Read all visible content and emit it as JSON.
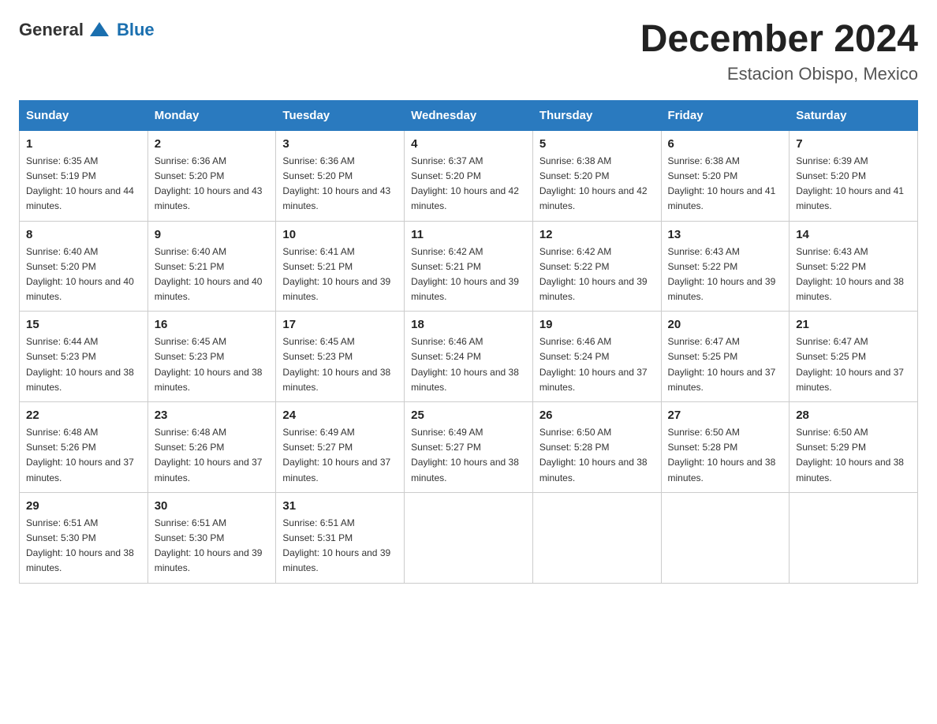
{
  "header": {
    "logo_general": "General",
    "logo_blue": "Blue",
    "month_year": "December 2024",
    "location": "Estacion Obispo, Mexico"
  },
  "weekdays": [
    "Sunday",
    "Monday",
    "Tuesday",
    "Wednesday",
    "Thursday",
    "Friday",
    "Saturday"
  ],
  "weeks": [
    [
      {
        "day": "1",
        "sunrise": "6:35 AM",
        "sunset": "5:19 PM",
        "daylight": "10 hours and 44 minutes."
      },
      {
        "day": "2",
        "sunrise": "6:36 AM",
        "sunset": "5:20 PM",
        "daylight": "10 hours and 43 minutes."
      },
      {
        "day": "3",
        "sunrise": "6:36 AM",
        "sunset": "5:20 PM",
        "daylight": "10 hours and 43 minutes."
      },
      {
        "day": "4",
        "sunrise": "6:37 AM",
        "sunset": "5:20 PM",
        "daylight": "10 hours and 42 minutes."
      },
      {
        "day": "5",
        "sunrise": "6:38 AM",
        "sunset": "5:20 PM",
        "daylight": "10 hours and 42 minutes."
      },
      {
        "day": "6",
        "sunrise": "6:38 AM",
        "sunset": "5:20 PM",
        "daylight": "10 hours and 41 minutes."
      },
      {
        "day": "7",
        "sunrise": "6:39 AM",
        "sunset": "5:20 PM",
        "daylight": "10 hours and 41 minutes."
      }
    ],
    [
      {
        "day": "8",
        "sunrise": "6:40 AM",
        "sunset": "5:20 PM",
        "daylight": "10 hours and 40 minutes."
      },
      {
        "day": "9",
        "sunrise": "6:40 AM",
        "sunset": "5:21 PM",
        "daylight": "10 hours and 40 minutes."
      },
      {
        "day": "10",
        "sunrise": "6:41 AM",
        "sunset": "5:21 PM",
        "daylight": "10 hours and 39 minutes."
      },
      {
        "day": "11",
        "sunrise": "6:42 AM",
        "sunset": "5:21 PM",
        "daylight": "10 hours and 39 minutes."
      },
      {
        "day": "12",
        "sunrise": "6:42 AM",
        "sunset": "5:22 PM",
        "daylight": "10 hours and 39 minutes."
      },
      {
        "day": "13",
        "sunrise": "6:43 AM",
        "sunset": "5:22 PM",
        "daylight": "10 hours and 39 minutes."
      },
      {
        "day": "14",
        "sunrise": "6:43 AM",
        "sunset": "5:22 PM",
        "daylight": "10 hours and 38 minutes."
      }
    ],
    [
      {
        "day": "15",
        "sunrise": "6:44 AM",
        "sunset": "5:23 PM",
        "daylight": "10 hours and 38 minutes."
      },
      {
        "day": "16",
        "sunrise": "6:45 AM",
        "sunset": "5:23 PM",
        "daylight": "10 hours and 38 minutes."
      },
      {
        "day": "17",
        "sunrise": "6:45 AM",
        "sunset": "5:23 PM",
        "daylight": "10 hours and 38 minutes."
      },
      {
        "day": "18",
        "sunrise": "6:46 AM",
        "sunset": "5:24 PM",
        "daylight": "10 hours and 38 minutes."
      },
      {
        "day": "19",
        "sunrise": "6:46 AM",
        "sunset": "5:24 PM",
        "daylight": "10 hours and 37 minutes."
      },
      {
        "day": "20",
        "sunrise": "6:47 AM",
        "sunset": "5:25 PM",
        "daylight": "10 hours and 37 minutes."
      },
      {
        "day": "21",
        "sunrise": "6:47 AM",
        "sunset": "5:25 PM",
        "daylight": "10 hours and 37 minutes."
      }
    ],
    [
      {
        "day": "22",
        "sunrise": "6:48 AM",
        "sunset": "5:26 PM",
        "daylight": "10 hours and 37 minutes."
      },
      {
        "day": "23",
        "sunrise": "6:48 AM",
        "sunset": "5:26 PM",
        "daylight": "10 hours and 37 minutes."
      },
      {
        "day": "24",
        "sunrise": "6:49 AM",
        "sunset": "5:27 PM",
        "daylight": "10 hours and 37 minutes."
      },
      {
        "day": "25",
        "sunrise": "6:49 AM",
        "sunset": "5:27 PM",
        "daylight": "10 hours and 38 minutes."
      },
      {
        "day": "26",
        "sunrise": "6:50 AM",
        "sunset": "5:28 PM",
        "daylight": "10 hours and 38 minutes."
      },
      {
        "day": "27",
        "sunrise": "6:50 AM",
        "sunset": "5:28 PM",
        "daylight": "10 hours and 38 minutes."
      },
      {
        "day": "28",
        "sunrise": "6:50 AM",
        "sunset": "5:29 PM",
        "daylight": "10 hours and 38 minutes."
      }
    ],
    [
      {
        "day": "29",
        "sunrise": "6:51 AM",
        "sunset": "5:30 PM",
        "daylight": "10 hours and 38 minutes."
      },
      {
        "day": "30",
        "sunrise": "6:51 AM",
        "sunset": "5:30 PM",
        "daylight": "10 hours and 39 minutes."
      },
      {
        "day": "31",
        "sunrise": "6:51 AM",
        "sunset": "5:31 PM",
        "daylight": "10 hours and 39 minutes."
      },
      null,
      null,
      null,
      null
    ]
  ]
}
